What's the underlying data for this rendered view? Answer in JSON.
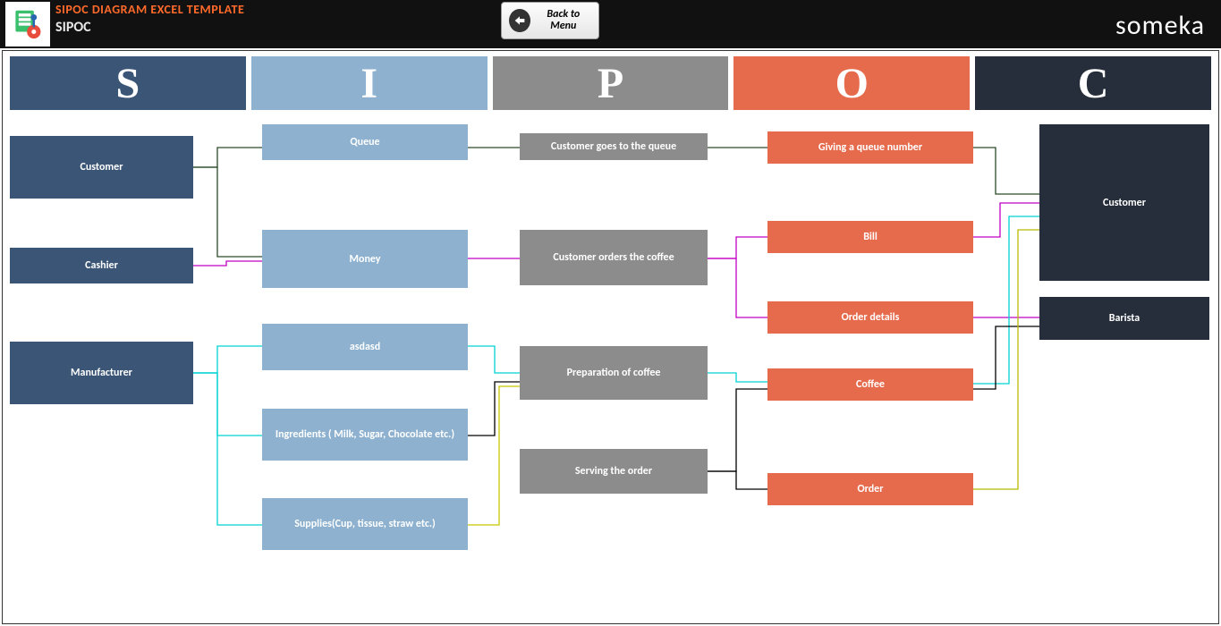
{
  "header": {
    "template_title": "SIPOC DIAGRAM EXCEL TEMPLATE",
    "page_title": "SIPOC",
    "back_button": "Back to Menu",
    "brand": "someka"
  },
  "columns": {
    "s": "S",
    "i": "I",
    "p": "P",
    "o": "O",
    "c": "C"
  },
  "suppliers": [
    "Customer",
    "Cashier",
    "Manufacturer"
  ],
  "inputs": [
    "Queue",
    "Money",
    "asdasd",
    "Ingredients ( Milk, Sugar, Chocolate etc.)",
    "Supplies(Cup, tissue, straw etc.)"
  ],
  "processes": [
    "Customer goes to the queue",
    "Customer orders the coffee",
    "Preparation of coffee",
    "Serving the order"
  ],
  "outputs": [
    "Giving a queue number",
    "Bill",
    "Order details",
    "Coffee",
    "Order"
  ],
  "customers": [
    "Customer",
    "Barista"
  ]
}
